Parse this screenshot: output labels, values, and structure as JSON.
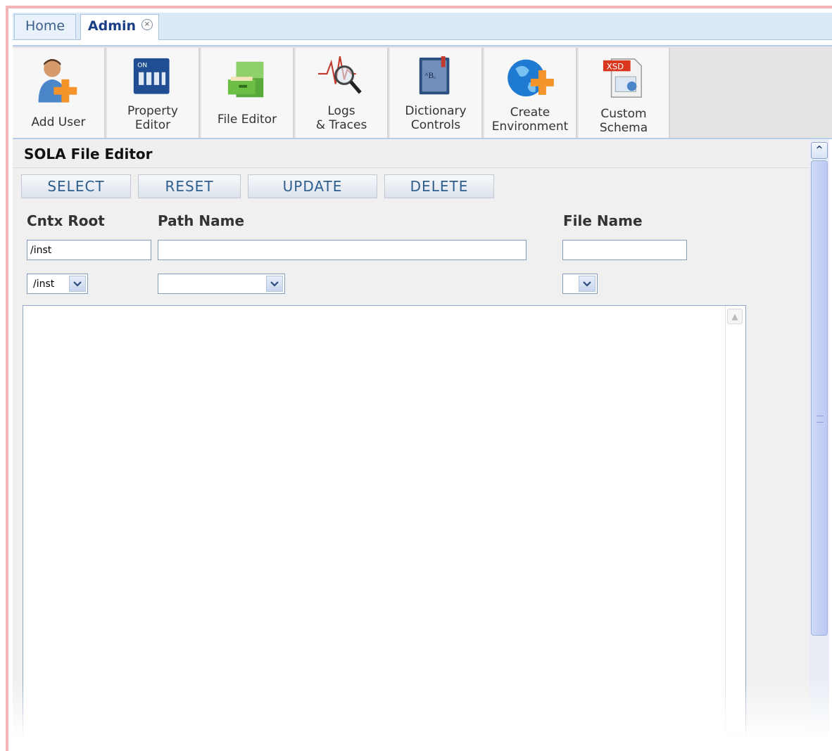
{
  "tabs": {
    "home": "Home",
    "admin": "Admin",
    "close_glyph": "×"
  },
  "toolbar": {
    "add_user": "Add User",
    "property_editor": [
      "Property",
      "Editor"
    ],
    "file_editor": "File Editor",
    "logs_traces": [
      "Logs",
      "& Traces"
    ],
    "dictionary_controls": [
      "Dictionary",
      "Controls"
    ],
    "create_environment": [
      "Create",
      "Environment"
    ],
    "custom_schema": [
      "Custom",
      "Schema"
    ],
    "on_label": "ON",
    "xsd_label": "XSD"
  },
  "panel": {
    "title": "SOLA File Editor",
    "buttons": {
      "select": "SELECT",
      "reset": "RESET",
      "update": "UPDATE",
      "delete": "DELETE"
    },
    "columns": {
      "cntx_root": "Cntx Root",
      "path_name": "Path Name",
      "file_name": "File Name"
    },
    "fields": {
      "cntx_root_value": "/inst",
      "path_name_value": "",
      "file_name_value": "",
      "cntx_root_select": "/inst",
      "path_name_select": "",
      "file_name_select": ""
    }
  },
  "colors": {
    "accent": "#2e5e8e",
    "tab_bg": "#dce9f7",
    "frame": "#f2b6b6"
  },
  "icons": [
    "add-user-icon",
    "property-editor-icon",
    "file-cabinet-icon",
    "logs-magnifier-icon",
    "dictionary-book-icon",
    "globe-plus-icon",
    "xsd-schema-icon"
  ]
}
